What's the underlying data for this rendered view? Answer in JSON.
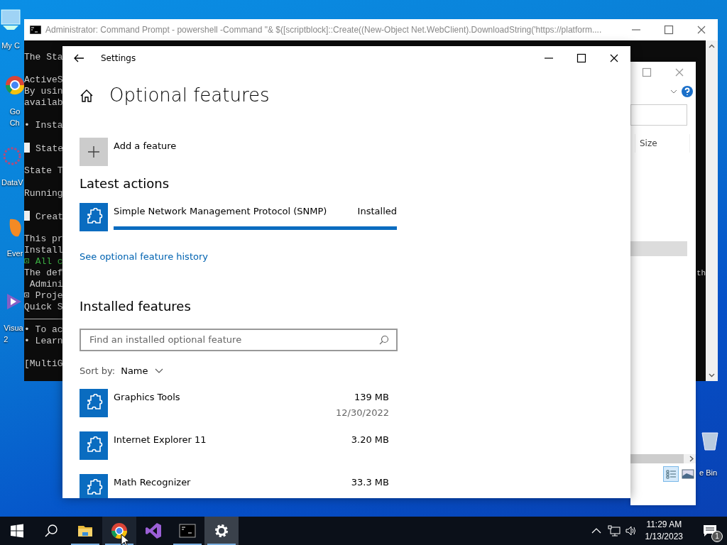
{
  "desktop_icons": [
    {
      "kind": "computer",
      "label_lines": [
        "My C"
      ]
    },
    {
      "kind": "chrome",
      "label_lines": [
        "Go",
        "Ch"
      ]
    },
    {
      "kind": "data",
      "label_lines": [
        "DataV"
      ]
    },
    {
      "kind": "ever",
      "label_lines": [
        "Ever"
      ]
    },
    {
      "kind": "studio",
      "label_lines": [
        "Visua",
        "2"
      ]
    },
    {
      "kind": "bin",
      "label_lines": [
        "e Bin"
      ]
    }
  ],
  "command_window": {
    "title": "Administrator:  Command Prompt - powershell  -Command \"& $([scriptblock]::Create((New-Object Net.WebClient).DownloadString('https://platform....",
    "paragraphs": [
      {
        "kind": "text",
        "lines": [
          {
            "kind": "plain",
            "text": "The Sta"
          }
        ]
      },
      {
        "kind": "text",
        "lines": [
          {
            "kind": "plain",
            "text": "ActiveS"
          },
          {
            "kind": "plain",
            "text": "By usin"
          },
          {
            "kind": "plain",
            "text": "availab"
          }
        ]
      },
      {
        "kind": "text",
        "lines": [
          {
            "kind": "plain",
            "text": "• Insta"
          }
        ]
      },
      {
        "kind": "text",
        "lines": [
          {
            "kind": "block",
            "text": "State"
          }
        ]
      },
      {
        "kind": "text",
        "lines": [
          {
            "kind": "plain",
            "text": "State T"
          }
        ]
      },
      {
        "kind": "text",
        "lines": [
          {
            "kind": "plain",
            "text": "Running"
          }
        ]
      },
      {
        "kind": "text",
        "lines": [
          {
            "kind": "block",
            "text": "Creat"
          }
        ]
      },
      {
        "kind": "text",
        "lines": [
          {
            "kind": "plain",
            "text": "This pr"
          },
          {
            "kind": "plain",
            "text": "Install"
          },
          {
            "kind": "green",
            "text": "⊡ All c"
          },
          {
            "kind": "plain",
            "text": "The def"
          },
          {
            "kind": "plain",
            "text": " Admini"
          },
          {
            "kind": "plain",
            "text": "⊡ Proje"
          },
          {
            "kind": "plain",
            "text": "Quick S"
          }
        ]
      },
      {
        "kind": "rule"
      },
      {
        "kind": "text",
        "lines": [
          {
            "kind": "plain",
            "text": "• To ac"
          },
          {
            "kind": "plain",
            "text": "• Learn"
          }
        ]
      },
      {
        "kind": "text",
        "lines": [
          {
            "kind": "plain",
            "text": "[MultiG"
          }
        ]
      }
    ],
    "right_fragment": "th"
  },
  "explorer_window": {
    "column_header": "Size"
  },
  "settings_window": {
    "title": "Settings",
    "heading": "Optional features",
    "add_button": "Add a feature",
    "latest_actions": {
      "heading": "Latest actions",
      "items": [
        {
          "name": "Simple Network Management Protocol (SNMP)",
          "status": "Installed",
          "level": 1
        }
      ]
    },
    "history_link": "See optional feature history",
    "installed": {
      "heading": "Installed features",
      "search": {
        "placeholder": "Find an installed optional feature"
      },
      "sort_label": "Sort by:",
      "sort_value": "Name",
      "features": [
        {
          "name": "Graphics Tools",
          "size": "139 MB",
          "date": "12/30/2022"
        },
        {
          "name": "Internet Explorer 11",
          "size": "3.20 MB"
        },
        {
          "name": "Math Recognizer",
          "size": "33.3 MB"
        }
      ]
    }
  },
  "taskbar": {
    "apps": [
      {
        "kind": "explorer",
        "running": true,
        "selected": false,
        "hovered": false
      },
      {
        "kind": "chrome",
        "running": true,
        "selected": false,
        "hovered": true
      },
      {
        "kind": "studio",
        "running": false,
        "selected": false,
        "hovered": false
      },
      {
        "kind": "terminal",
        "running": true,
        "selected": false,
        "hovered": false
      },
      {
        "kind": "settings",
        "running": true,
        "selected": true,
        "hovered": false
      }
    ],
    "time": "11:29 AM",
    "date": "1/13/2023",
    "notification_count": "1"
  }
}
